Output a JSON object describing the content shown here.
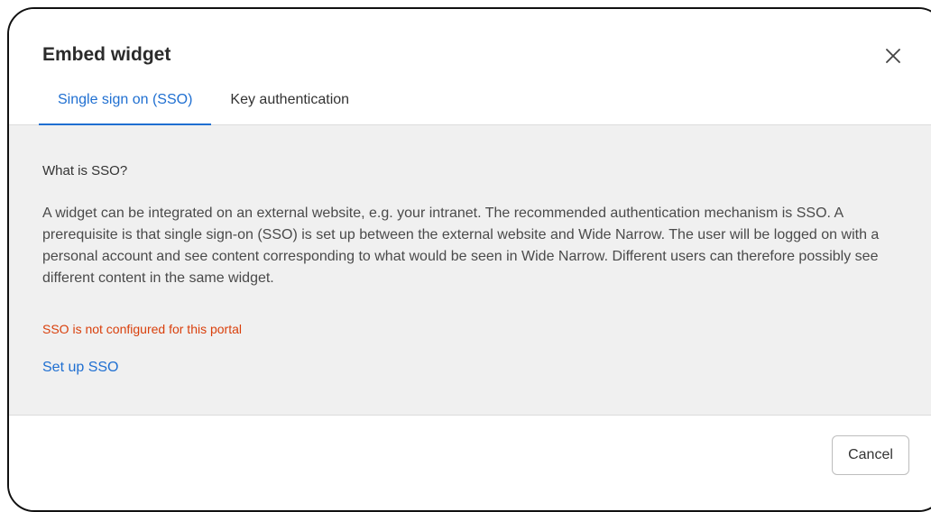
{
  "dialog": {
    "title": "Embed widget",
    "close_icon": "close-icon"
  },
  "tabs": [
    {
      "label": "Single sign on (SSO)",
      "active": true
    },
    {
      "label": "Key authentication",
      "active": false
    }
  ],
  "content": {
    "heading": "What is SSO?",
    "description": "A widget can be integrated on an external website, e.g. your intranet. The recommended authentication mechanism is SSO. A prerequisite is that single sign-on (SSO) is set up between the external website and Wide Narrow. The user will be logged on with a personal account and see content corresponding to what would be seen in Wide Narrow. Different users can therefore possibly see different content in the same widget.",
    "error": "SSO is not configured for this portal",
    "setup_link": "Set up SSO"
  },
  "footer": {
    "cancel_label": "Cancel"
  },
  "colors": {
    "accent": "#1f6fd1",
    "error": "#d93f0b",
    "panel_background": "#f0f0f0"
  }
}
